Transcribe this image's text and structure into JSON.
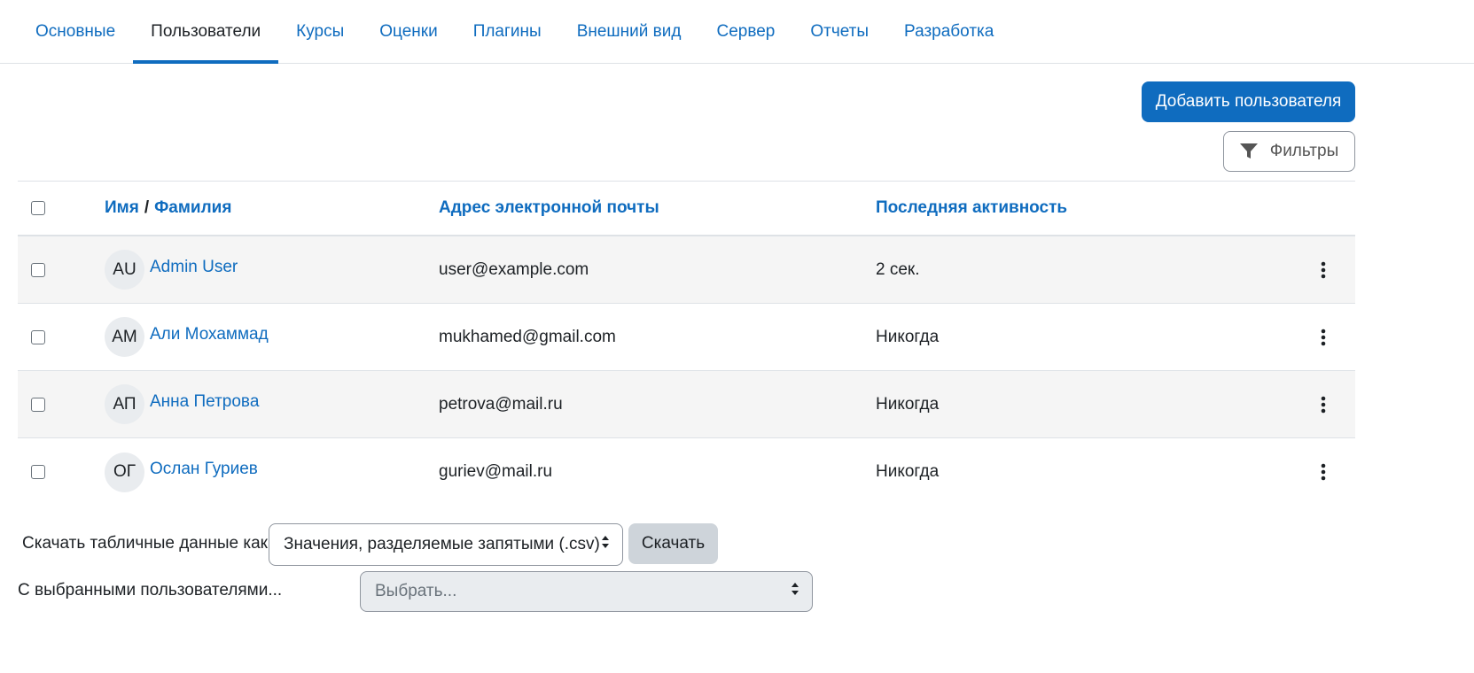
{
  "tabs": [
    {
      "label": "Основные"
    },
    {
      "label": "Пользователи"
    },
    {
      "label": "Курсы"
    },
    {
      "label": "Оценки"
    },
    {
      "label": "Плагины"
    },
    {
      "label": "Внешний вид"
    },
    {
      "label": "Сервер"
    },
    {
      "label": "Отчеты"
    },
    {
      "label": "Разработка"
    }
  ],
  "active_tab": "Пользователи",
  "toolbar": {
    "add_user_label": "Добавить пользователя",
    "filters_label": "Фильтры",
    "filter_icon": "funnel-icon"
  },
  "table": {
    "headers": {
      "first_name": "Имя",
      "separator": "/",
      "last_name": "Фамилия",
      "email": "Адрес электронной почты",
      "last_access": "Последняя активность"
    },
    "rows": [
      {
        "initials": "AU",
        "name": "Admin User",
        "email": "user@example.com",
        "last_access": "2 сек."
      },
      {
        "initials": "АМ",
        "name": "Али Мохаммад",
        "email": "mukhamed@gmail.com",
        "last_access": "Никогда"
      },
      {
        "initials": "АП",
        "name": "Анна Петрова",
        "email": "petrova@mail.ru",
        "last_access": "Никогда"
      },
      {
        "initials": "ОГ",
        "name": "Ослан Гуриев",
        "email": "guriev@mail.ru",
        "last_access": "Никогда"
      }
    ],
    "row_menu_icon": "kebab-menu-icon"
  },
  "download": {
    "label": "Скачать табличные данные как",
    "format_selected": "Значения, разделяемые запятыми (.csv)",
    "button_label": "Скачать"
  },
  "bulk": {
    "label": "С выбранными пользователями...",
    "placeholder": "Выбрать..."
  },
  "colors": {
    "accent": "#0f6cbf",
    "text": "#1d2125",
    "stripe": "#f5f5f5",
    "disabled_bg": "#e9ecef"
  }
}
